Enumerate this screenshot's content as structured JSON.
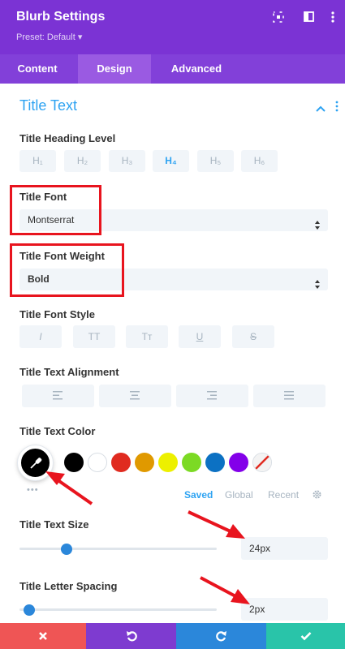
{
  "header": {
    "title": "Blurb Settings",
    "preset": "Preset: Default ▾",
    "icons": [
      "target-icon",
      "split-view-icon",
      "more-icon"
    ]
  },
  "tabs": [
    {
      "label": "Content",
      "active": false
    },
    {
      "label": "Design",
      "active": true
    },
    {
      "label": "Advanced",
      "active": false
    }
  ],
  "section": {
    "title": "Title Text"
  },
  "heading_level": {
    "label": "Title Heading Level",
    "options": [
      "H₁",
      "H₂",
      "H₃",
      "H₄",
      "H₅",
      "H₆"
    ],
    "selected": "H₄"
  },
  "title_font": {
    "label": "Title Font",
    "value": "Montserrat"
  },
  "title_font_weight": {
    "label": "Title Font Weight",
    "value": "Bold"
  },
  "title_font_style": {
    "label": "Title Font Style",
    "options": [
      "I",
      "TT",
      "Tт",
      "U",
      "S"
    ]
  },
  "title_text_alignment": {
    "label": "Title Text Alignment"
  },
  "title_text_color": {
    "label": "Title Text Color",
    "selected_color": "#000000",
    "swatches": [
      "#000000",
      "#ffffff",
      "#e02b20",
      "#e09900",
      "#edf000",
      "#7cda24",
      "#0c71c3",
      "#8300e9"
    ],
    "more": "•••",
    "tabs": [
      {
        "label": "Saved",
        "active": true
      },
      {
        "label": "Global",
        "active": false
      },
      {
        "label": "Recent",
        "active": false
      }
    ]
  },
  "title_text_size": {
    "label": "Title Text Size",
    "value": "24px",
    "fraction": 0.24
  },
  "title_letter_spacing": {
    "label": "Title Letter Spacing",
    "value": "2px",
    "fraction": 0.05
  },
  "footer": {
    "buttons": [
      {
        "name": "close",
        "color": "#ef5555"
      },
      {
        "name": "undo",
        "color": "#7e3bd0"
      },
      {
        "name": "redo",
        "color": "#2b87da"
      },
      {
        "name": "save",
        "color": "#29c4a9"
      }
    ]
  },
  "colors": {
    "header": "#7b33d4",
    "accent": "#2ea3f2",
    "annotation_red": "#e8141e"
  }
}
